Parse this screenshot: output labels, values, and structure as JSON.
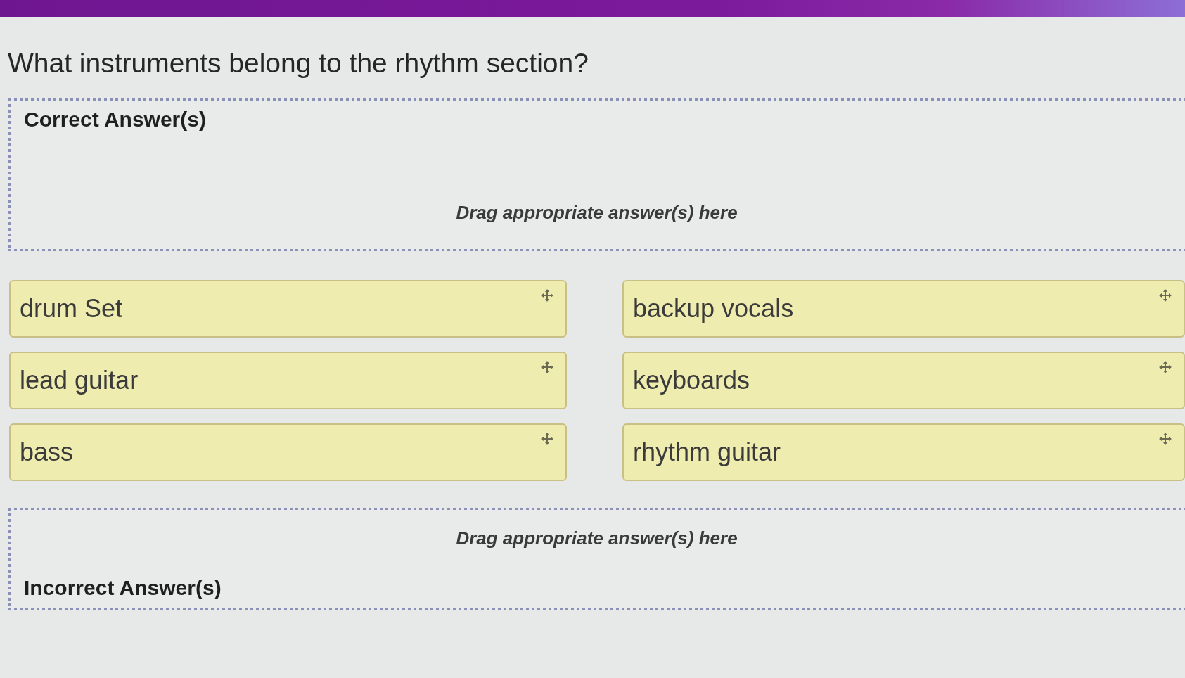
{
  "question": "What instruments belong to the rhythm section?",
  "correct_zone": {
    "title": "Correct Answer(s)",
    "placeholder": "Drag appropriate answer(s) here"
  },
  "answer_choices": [
    "drum Set",
    "backup vocals",
    "lead guitar",
    "keyboards",
    "bass",
    "rhythm guitar"
  ],
  "incorrect_zone": {
    "title": "Incorrect Answer(s)",
    "placeholder": "Drag appropriate answer(s) here"
  }
}
